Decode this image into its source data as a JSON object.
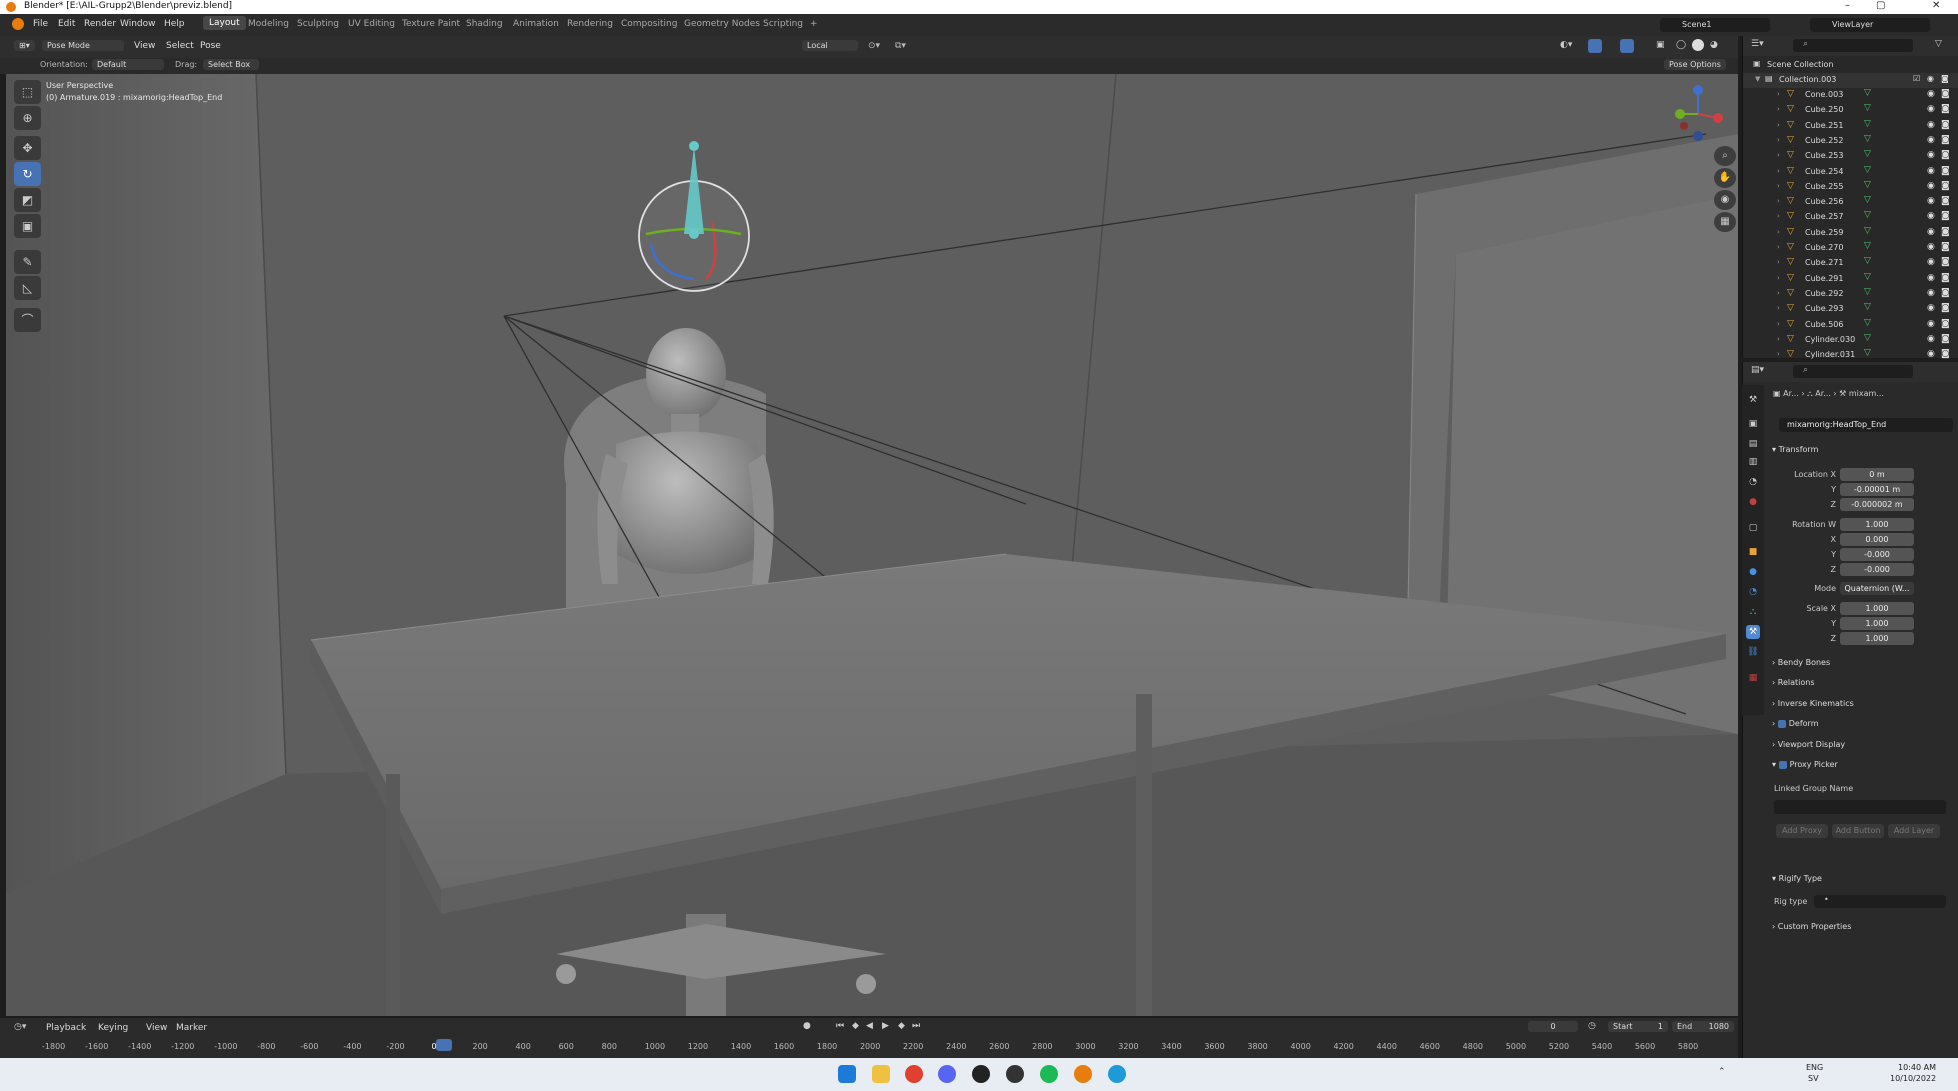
{
  "titlebar": {
    "title": "Blender* [E:\\AIL-Grupp2\\Blender\\previz.blend]",
    "minimize": "–",
    "maximize": "▢",
    "close": "✕"
  },
  "menu": {
    "items": [
      "File",
      "Edit",
      "Render",
      "Window",
      "Help"
    ]
  },
  "workspaces": {
    "tabs": [
      "Layout",
      "Modeling",
      "Sculpting",
      "UV Editing",
      "Texture Paint",
      "Shading",
      "Animation",
      "Rendering",
      "Compositing",
      "Geometry Nodes",
      "Scripting"
    ],
    "add": "+",
    "active": "Layout"
  },
  "scene": {
    "name": "Scene1",
    "view_layer": "ViewLayer"
  },
  "viewport_header": {
    "mode": "Pose Mode",
    "menus": [
      "View",
      "Select",
      "Pose"
    ],
    "transform": "Local",
    "orientation_label": "Orientation:",
    "orientation_value": "Default",
    "drag_label": "Drag:",
    "drag_value": "Select Box",
    "pose_options": "Pose Options"
  },
  "viewport": {
    "perspective": "User Perspective",
    "active_info": "(0) Armature.019 : mixamorig:HeadTop_End"
  },
  "toolbar": {
    "tools": [
      "select-icon",
      "cursor-icon",
      "move-icon",
      "rotate-icon",
      "scale-icon",
      "transform-icon",
      "annotate-icon",
      "measure-icon",
      "relax-icon"
    ],
    "active": "rotate-icon"
  },
  "outliner": {
    "scene_collection": "Scene Collection",
    "collection": "Collection.003",
    "objects": [
      "Cone.003",
      "Cube.250",
      "Cube.251",
      "Cube.252",
      "Cube.253",
      "Cube.254",
      "Cube.255",
      "Cube.256",
      "Cube.257",
      "Cube.259",
      "Cube.270",
      "Cube.271",
      "Cube.291",
      "Cube.292",
      "Cube.293",
      "Cube.506",
      "Cylinder.030",
      "Cylinder.031"
    ]
  },
  "properties": {
    "breadcrumb": [
      "Ar...",
      "Ar...",
      "mixam..."
    ],
    "bone_name": "mixamorig:HeadTop_End",
    "transform_title": "Transform",
    "location": {
      "label": "Location X",
      "x": "0 m",
      "y": "-0.00001 m",
      "z": "-0.000002 m"
    },
    "rotation": {
      "label": "Rotation W",
      "w": "1.000",
      "x": "0.000",
      "y": "-0.000",
      "z": "-0.000"
    },
    "axis_labels": {
      "x": "X",
      "y": "Y",
      "z": "Z"
    },
    "mode_label": "Mode",
    "mode_value": "Quaternion (W...",
    "scale": {
      "label": "Scale X",
      "x": "1.000",
      "y": "1.000",
      "z": "1.000"
    },
    "sections": [
      "Bendy Bones",
      "Relations",
      "Inverse Kinematics",
      "Deform",
      "Viewport Display",
      "Proxy Picker"
    ],
    "checked_sections": [
      "Deform",
      "Proxy Picker"
    ],
    "linked_group_label": "Linked Group Name",
    "buttons": [
      "Add Proxy",
      "Add Button",
      "Add Layer"
    ],
    "rigify_type_title": "Rigify Type",
    "rigtype_label": "Rig type",
    "rigtype_value": "•",
    "custom_props": "Custom Properties"
  },
  "timeline": {
    "menus": [
      "Playback",
      "Keying",
      "View",
      "Marker"
    ],
    "current_frame": "0",
    "start_label": "Start",
    "start": "1",
    "end_label": "End",
    "end": "1080",
    "ticks": [
      "-1800",
      "-1600",
      "-1400",
      "-1200",
      "-1000",
      "-800",
      "-600",
      "-400",
      "-200",
      "0",
      "200",
      "400",
      "600",
      "800",
      "1000",
      "1200",
      "1400",
      "1600",
      "1800",
      "2000",
      "2200",
      "2400",
      "2600",
      "2800",
      "3000",
      "3200",
      "3400",
      "3600",
      "3800",
      "4000",
      "4200",
      "4400",
      "4600",
      "4800",
      "5000",
      "5200",
      "5400",
      "5600",
      "5800"
    ]
  },
  "taskbar": {
    "lang": "ENG",
    "region": "SV",
    "time": "10:40 AM",
    "date": "10/10/2022"
  }
}
